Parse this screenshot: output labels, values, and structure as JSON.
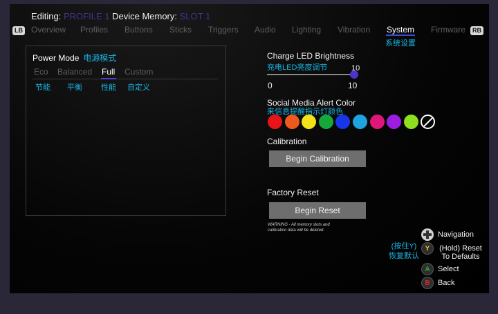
{
  "header": {
    "editing_label": "Editing:",
    "profile_value": "PROFILE 1",
    "memory_label": "Device Memory:",
    "memory_value": "SLOT 1"
  },
  "tabs": {
    "left_bumper": "LB",
    "right_bumper": "RB",
    "items": [
      "Overview",
      "Profiles",
      "Buttons",
      "Sticks",
      "Triggers",
      "Audio",
      "Lighting",
      "Vibration",
      "System",
      "Firmware"
    ],
    "active": "System",
    "active_cn": "系统设置"
  },
  "power_mode": {
    "title": "Power Mode",
    "title_cn": "电源模式",
    "options": [
      "Eco",
      "Balanced",
      "Full",
      "Custom"
    ],
    "options_cn": [
      "节能",
      "平衡",
      "性能",
      "自定义"
    ],
    "selected": "Full"
  },
  "charge_led": {
    "title": "Charge LED Brightness",
    "title_cn": "充电LED亮度调节",
    "value": "10",
    "min": "0",
    "max": "10"
  },
  "social_alert": {
    "title": "Social Media Alert Color",
    "title_cn": "来信息提醒指示灯颜色",
    "colors": [
      "#e8141a",
      "#ee5a1c",
      "#f2e21a",
      "#17a83a",
      "#1736e8",
      "#1fa3e0",
      "#e0177a",
      "#9b1de0",
      "#8ee01f"
    ],
    "none_icon": "none-slash-icon"
  },
  "calibration": {
    "title": "Calibration",
    "button": "Begin Calibration"
  },
  "factory_reset": {
    "title": "Factory Reset",
    "button": "Begin Reset",
    "warning": "WARNING - All memory slots and calibration data will be deleted."
  },
  "legend": {
    "hint_cn_1": "(按住Y)",
    "hint_cn_2": "恢复默认",
    "items": [
      {
        "icon": "dpad-icon",
        "glyph": "",
        "label": "Navigation",
        "color": "#cccccc"
      },
      {
        "icon": "y-button-icon",
        "glyph": "Y",
        "label": "(Hold) Reset To Defaults",
        "color": "#e6c21a"
      },
      {
        "icon": "a-button-icon",
        "glyph": "A",
        "label": "Select",
        "color": "#27a53a"
      },
      {
        "icon": "b-button-icon",
        "glyph": "B",
        "label": "Back",
        "color": "#d9232a"
      }
    ]
  }
}
